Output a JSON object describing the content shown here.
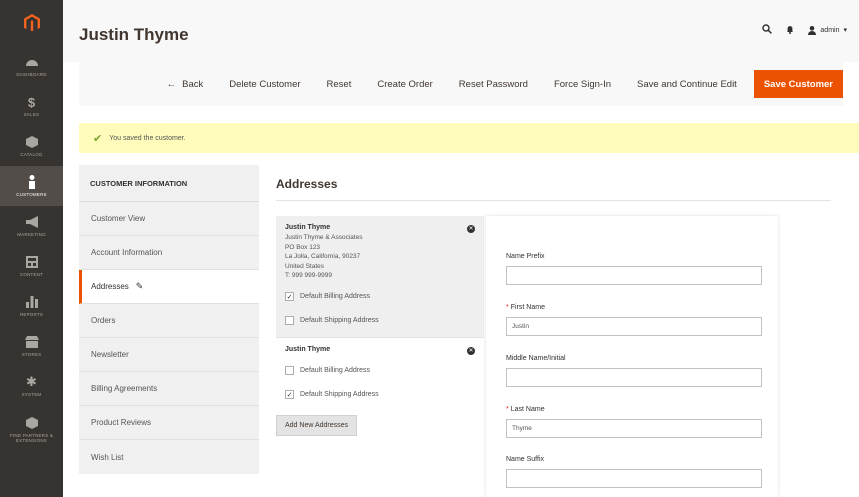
{
  "header": {
    "page_title": "Justin Thyme",
    "admin_label": "admin"
  },
  "sidebar": {
    "items": [
      {
        "label": "Dashboard",
        "icon": "dashboard-icon"
      },
      {
        "label": "Sales",
        "icon": "dollar-icon"
      },
      {
        "label": "Catalog",
        "icon": "cube-icon"
      },
      {
        "label": "Customers",
        "icon": "person-icon",
        "active": true
      },
      {
        "label": "Marketing",
        "icon": "megaphone-icon"
      },
      {
        "label": "Content",
        "icon": "content-icon"
      },
      {
        "label": "Reports",
        "icon": "bar-chart-icon"
      },
      {
        "label": "Stores",
        "icon": "store-icon"
      },
      {
        "label": "System",
        "icon": "gear-icon"
      },
      {
        "label": "Find Partners & Extensions",
        "icon": "partners-icon"
      }
    ]
  },
  "actions": {
    "back": "Back",
    "delete": "Delete Customer",
    "reset": "Reset",
    "create_order": "Create Order",
    "reset_password": "Reset Password",
    "force_signin": "Force Sign-In",
    "save_continue": "Save and Continue Edit",
    "save": "Save Customer"
  },
  "message": "You saved the customer.",
  "tabs": {
    "title": "CUSTOMER INFORMATION",
    "items": [
      "Customer View",
      "Account Information",
      "Addresses",
      "Orders",
      "Newsletter",
      "Billing Agreements",
      "Product Reviews",
      "Wish List"
    ],
    "active": "Addresses"
  },
  "section_title": "Addresses",
  "addresses": [
    {
      "name": "Justin Thyme",
      "lines": [
        "Justin Thyme & Associates",
        "PO Box 123",
        "La Jolla, California, 90237",
        "United States",
        "T: 999 999-9999"
      ],
      "default_billing": {
        "label": "Default Billing Address",
        "checked": true
      },
      "default_shipping": {
        "label": "Default Shipping Address",
        "checked": false
      }
    },
    {
      "name": "Justin Thyme",
      "lines": [],
      "default_billing": {
        "label": "Default Billing Address",
        "checked": false
      },
      "default_shipping": {
        "label": "Default Shipping Address",
        "checked": true
      }
    }
  ],
  "add_button": "Add New Addresses",
  "form": {
    "name_prefix": {
      "label": "Name Prefix",
      "value": ""
    },
    "first_name": {
      "label": "First Name",
      "value": "Justin",
      "required": true
    },
    "middle_name": {
      "label": "Middle Name/Initial",
      "value": ""
    },
    "last_name": {
      "label": "Last Name",
      "value": "Thyme",
      "required": true
    },
    "name_suffix": {
      "label": "Name Suffix",
      "value": ""
    }
  },
  "colors": {
    "accent": "#eb5202",
    "sidebar": "#373330",
    "message_bg": "#fffbbb",
    "success": "#79a22e"
  }
}
